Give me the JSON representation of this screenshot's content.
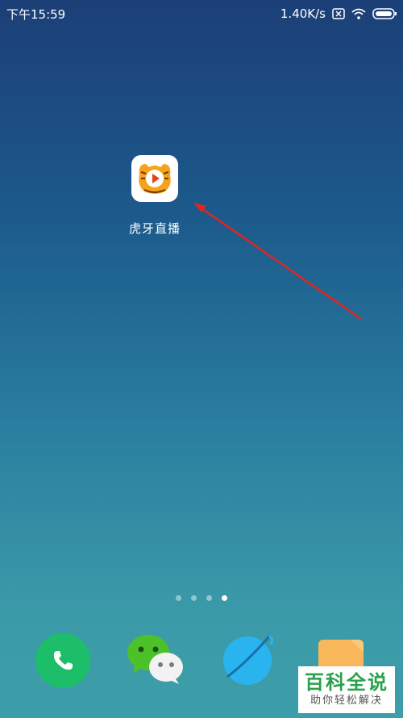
{
  "status_bar": {
    "time": "下午15:59",
    "network_speed": "1.40K/s",
    "icons": [
      "sim-x-icon",
      "wifi-icon",
      "battery-icon"
    ]
  },
  "home": {
    "app_label": "虎牙直播",
    "app_icon": "huya-tiger-icon",
    "page_indicator": {
      "count": 4,
      "active_index": 3
    }
  },
  "dock": {
    "apps": [
      "phone-icon",
      "wechat-icon",
      "browser-icon",
      "notes-icon"
    ]
  },
  "watermark": {
    "title": "百科全说",
    "subtitle": "助你轻松解决"
  },
  "colors": {
    "phone_green": "#1dbe6a",
    "arrow_red": "#e0261f",
    "watermark_green": "#2aa14a",
    "notes_orange": "#f7b75a"
  }
}
